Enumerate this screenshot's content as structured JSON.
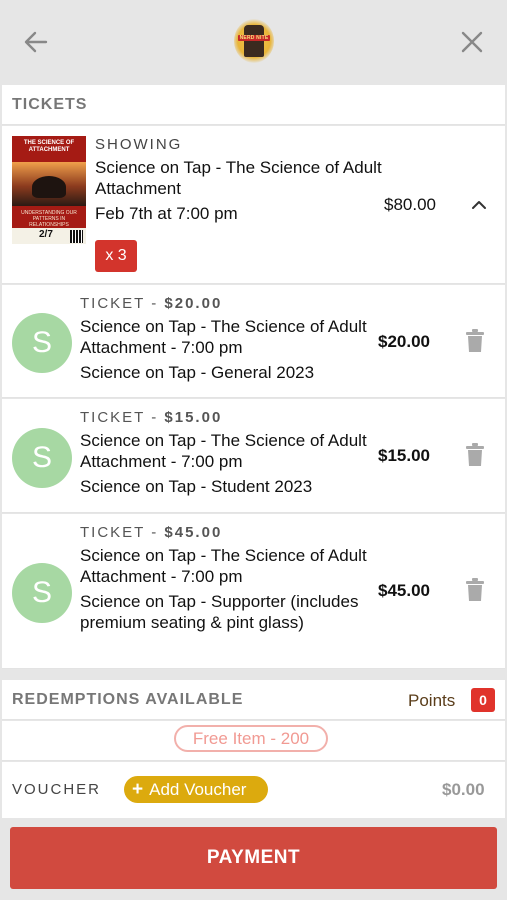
{
  "header": {
    "back_icon": "arrow-left-icon",
    "close_icon": "close-icon",
    "logo_text": "NERD NITE"
  },
  "tickets_section": {
    "title": "TICKETS"
  },
  "showing": {
    "label": "SHOWING",
    "title": "Science on Tap - The Science of Adult Attachment",
    "date": "Feb 7th at 7:00 pm",
    "price": "$80.00",
    "quantity": "x 3",
    "poster": {
      "title": "THE SCIENCE OF ATTACHMENT",
      "subtitle": "UNDERSTANDING OUR PATTERNS IN RELATIONSHIPS",
      "date": "2/7"
    }
  },
  "tickets": [
    {
      "avatar": "S",
      "head_prefix": "TICKET - ",
      "head_amount": "$20.00",
      "name": "Science on Tap - The Science of Adult Attachment - 7:00 pm",
      "type": "Science on Tap - General 2023",
      "price": "$20.00"
    },
    {
      "avatar": "S",
      "head_prefix": "TICKET - ",
      "head_amount": "$15.00",
      "name": "Science on Tap - The Science of Adult Attachment - 7:00 pm",
      "type": "Science on Tap - Student 2023",
      "price": "$15.00"
    },
    {
      "avatar": "S",
      "head_prefix": "TICKET - ",
      "head_amount": "$45.00",
      "name": "Science on Tap - The Science of Adult Attachment - 7:00 pm",
      "type": "Science on Tap - Supporter (includes premium seating & pint glass)",
      "price": "$45.00"
    }
  ],
  "redemptions": {
    "title": "REDEMPTIONS AVAILABLE",
    "points_label": "Points",
    "points_count": "0",
    "free_item": "Free Item - 200"
  },
  "voucher": {
    "label": "VOUCHER",
    "add_label": "Add Voucher",
    "amount": "$0.00"
  },
  "payment": {
    "label": "PAYMENT"
  },
  "colors": {
    "accent_red": "#d14a3f",
    "badge_red": "#d3342c",
    "voucher_gold": "#dcaa0e",
    "avatar_green": "#a7d8a3",
    "free_item_pink": "#f19a93"
  }
}
